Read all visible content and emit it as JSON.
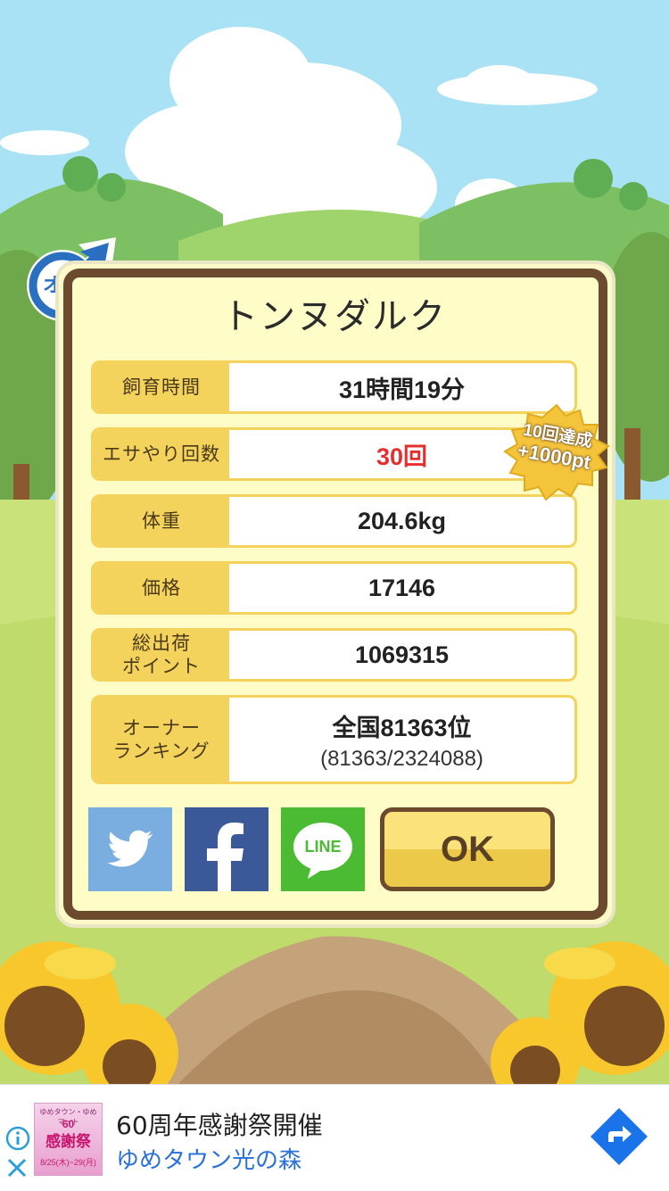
{
  "pet_name": "トンヌダルク",
  "gender_badge": {
    "label": "オス",
    "icon": "male-symbol-icon"
  },
  "stats": [
    {
      "label": "飼育時間",
      "value": "31時間19分"
    },
    {
      "label": "エサやり回数",
      "value": "30回"
    },
    {
      "label": "体重",
      "value": "204.6kg"
    },
    {
      "label": "価格",
      "value": "17146"
    },
    {
      "label_line1": "総出荷",
      "label_line2": "ポイント",
      "value": "1069315"
    },
    {
      "label_line1": "オーナー",
      "label_line2": "ランキング",
      "value": "全国81363位",
      "sub": "(81363/2324088)"
    }
  ],
  "achievement_badge": {
    "line1": "10回達成",
    "line2": "+1000pt"
  },
  "share_buttons": [
    {
      "icon": "twitter-icon"
    },
    {
      "icon": "facebook-icon"
    },
    {
      "icon": "line-icon",
      "label": "LINE"
    }
  ],
  "ok_button_label": "OK",
  "ad": {
    "thumb_top": "ゆめタウン・ゆめマート",
    "thumb_main": "感謝祭",
    "thumb_badge": "60",
    "thumb_dates": "8/25(木)~29(月)",
    "title": "60周年感謝祭開催",
    "subtitle": "ゆめタウン光の森"
  },
  "colors": {
    "sky": "#a8e2f4",
    "frame_brown": "#6b4a2d",
    "label_yellow": "#f4d35d",
    "accent_red": "#e52f2f",
    "twitter": "#7aaee0",
    "facebook": "#3b5998",
    "line": "#4cbb34"
  }
}
